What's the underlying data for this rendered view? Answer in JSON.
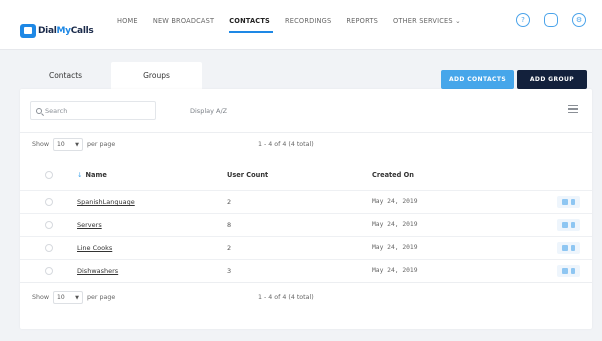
{
  "app": {
    "logo_prefix": "Dial",
    "logo_accent": "My",
    "logo_suffix": "Calls"
  },
  "nav": {
    "items": [
      {
        "label": "HOME"
      },
      {
        "label": "NEW BROADCAST"
      },
      {
        "label": "CONTACTS",
        "active": true
      },
      {
        "label": "RECORDINGS"
      },
      {
        "label": "REPORTS"
      },
      {
        "label": "OTHER SERVICES ⌄"
      }
    ],
    "icons": [
      "help-icon",
      "chat-icon",
      "settings-icon"
    ]
  },
  "tabs": {
    "contacts": "Contacts",
    "groups": "Groups"
  },
  "buttons": {
    "add_contacts": "ADD CONTACTS",
    "add_group": "ADD GROUP"
  },
  "toolbar": {
    "search_placeholder": "Search",
    "display_az": "Display A/Z"
  },
  "pager": {
    "show": "Show",
    "per_page_value": "10",
    "per_page": "per page",
    "summary": "1 - 4 of 4 (4 total)"
  },
  "table": {
    "columns": {
      "name": "Name",
      "user_count": "User Count",
      "created_on": "Created On"
    },
    "rows": [
      {
        "name": "SpanishLanguage",
        "user_count": "2",
        "created_on": "May 24, 2019"
      },
      {
        "name": "Servers",
        "user_count": "8",
        "created_on": "May 24, 2019"
      },
      {
        "name": "Line Cooks",
        "user_count": "2",
        "created_on": "May 24, 2019"
      },
      {
        "name": "Dishwashers",
        "user_count": "3",
        "created_on": "May 24, 2019"
      }
    ]
  },
  "colors": {
    "accent": "#46a6ea",
    "dark_button": "#13213c"
  }
}
